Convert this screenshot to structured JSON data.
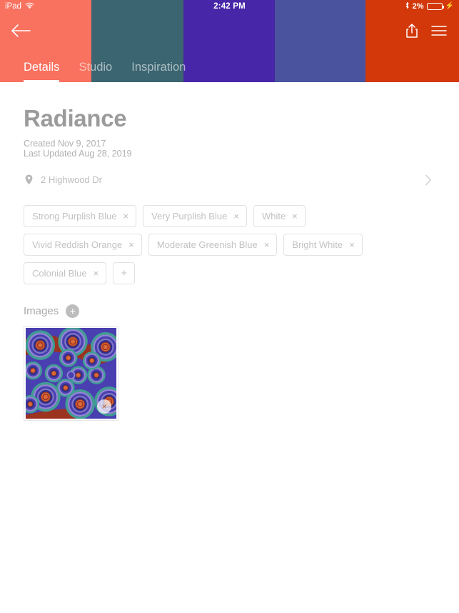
{
  "status_bar": {
    "device": "iPad",
    "wifi_icon": "wifi-icon",
    "time": "2:42 PM",
    "bluetooth_icon": "bluetooth-icon",
    "battery_percent": "2%",
    "battery_icon": "battery-icon",
    "charging_icon": "charging-bolt-icon"
  },
  "header": {
    "palette_colors": [
      "#f9715f",
      "#3b6570",
      "#4726a8",
      "#4a539e",
      "#d23809"
    ],
    "back_icon": "back-arrow-icon",
    "share_icon": "share-icon",
    "menu_icon": "hamburger-menu-icon",
    "tabs": [
      {
        "label": "Details",
        "active": true
      },
      {
        "label": "Studio",
        "active": false
      },
      {
        "label": "Inspiration",
        "active": false
      }
    ]
  },
  "details": {
    "title": "Radiance",
    "created": "Created Nov 9, 2017",
    "last_updated": "Last Updated Aug 28, 2019",
    "location": {
      "pin_icon": "map-pin-icon",
      "address": "2 Highwood Dr",
      "chevron_icon": "chevron-right-icon"
    }
  },
  "color_tags": {
    "remove_symbol": "×",
    "add_symbol": "+",
    "items": [
      "Strong Purplish Blue",
      "Very Purplish Blue",
      "White",
      "Vivid Reddish Orange",
      "Moderate Greenish Blue",
      "Bright White",
      "Colonial Blue"
    ]
  },
  "images": {
    "section_label": "Images",
    "add_symbol": "+",
    "delete_symbol": "×",
    "thumbnails": [
      {
        "name": "spiral-artwork-thumbnail",
        "background": "#9c3220",
        "palette": [
          "#4a3fb0",
          "#3f9e94",
          "#d96b3a",
          "#8f86d6",
          "#2f2f8c"
        ]
      }
    ]
  }
}
